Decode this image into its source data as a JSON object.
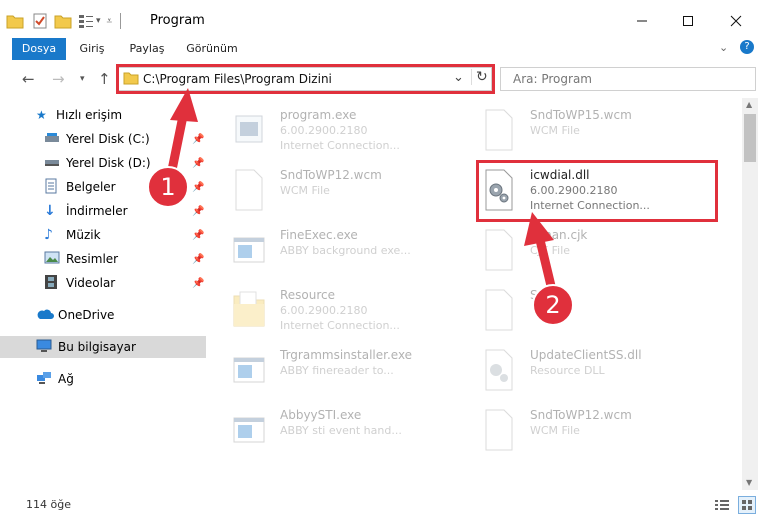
{
  "window": {
    "title": "Program"
  },
  "ribbon": {
    "tabs": [
      "Dosya",
      "Giriş",
      "Paylaş",
      "Görünüm"
    ]
  },
  "address": {
    "path": "C:\\Program Files\\Program Dizini"
  },
  "search": {
    "placeholder": "Ara: Program"
  },
  "nav": {
    "quick_access": "Hızlı erişim",
    "items": [
      "Yerel Disk (C:)",
      "Yerel Disk (D:)",
      "Belgeler",
      "İndirmeler",
      "Müzik",
      "Resimler",
      "Videolar"
    ],
    "onedrive": "OneDrive",
    "this_pc": "Bu bilgisayar",
    "network": "Ağ"
  },
  "files": [
    {
      "name": "program.exe",
      "line2": "6.00.2900.2180",
      "line3": "Internet Connection...",
      "icon": "exe-icon"
    },
    {
      "name": "SndToWP15.wcm",
      "line2": "WCM File",
      "line3": "",
      "icon": "blank-file-icon"
    },
    {
      "name": "SndToWP12.wcm",
      "line2": "WCM File",
      "line3": "",
      "icon": "blank-file-icon"
    },
    {
      "name": "icwdial.dll",
      "line2": "6.00.2900.2180",
      "line3": "Internet Connection...",
      "icon": "dll-gear-icon"
    },
    {
      "name": "FineExec.exe",
      "line2": "ABBY background exe...",
      "line3": "",
      "icon": "window-exe-icon"
    },
    {
      "name": "kanan.cjk",
      "line2": "CJK File",
      "line3": "",
      "icon": "blank-file-icon"
    },
    {
      "name": "Resource",
      "line2": "6.00.2900.2180",
      "line3": "Internet Connection...",
      "icon": "folder-icon"
    },
    {
      "name": "Sfsdff",
      "line2": "",
      "line3": "",
      "icon": "blank-file-icon"
    },
    {
      "name": "Trgrammsinstaller.exe",
      "line2": "ABBY finereader to...",
      "line3": "",
      "icon": "window-exe-icon"
    },
    {
      "name": "UpdateClientSS.dll",
      "line2": "Resource DLL",
      "line3": "",
      "icon": "dll-gear-icon"
    },
    {
      "name": "AbbyySTI.exe",
      "line2": "ABBY sti event hand...",
      "line3": "",
      "icon": "window-exe-icon"
    },
    {
      "name": "SndToWP12.wcm",
      "line2": "WCM File",
      "line3": "",
      "icon": "blank-file-icon"
    }
  ],
  "status": {
    "count": "114 öğe"
  },
  "annotations": {
    "step1": "1",
    "step2": "2"
  },
  "colors": {
    "accent": "#1979ca",
    "highlight": "#e0303c",
    "folder": "#f2c94c"
  }
}
